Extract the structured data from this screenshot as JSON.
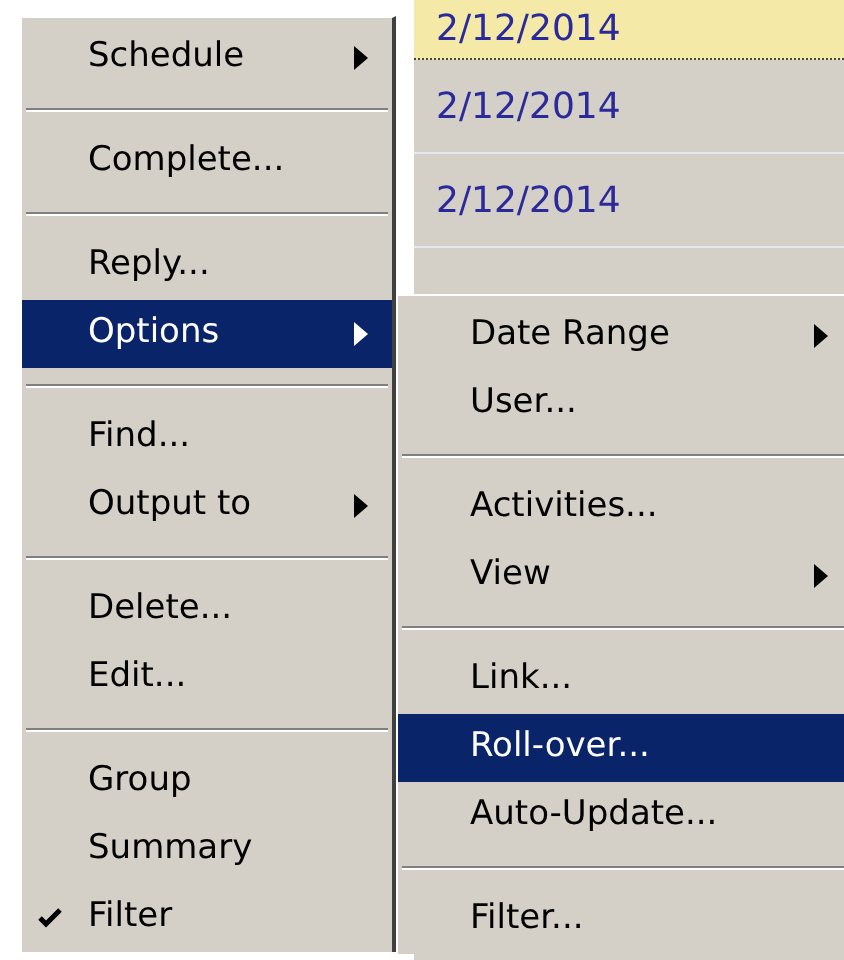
{
  "list": {
    "rows": [
      {
        "date": "2/12/2014",
        "selected": true
      },
      {
        "date": "2/12/2014",
        "selected": false
      },
      {
        "date": "2/12/2014",
        "selected": false
      }
    ]
  },
  "menu": {
    "items": [
      {
        "kind": "item",
        "label": "Schedule",
        "submenu": true,
        "checked": false,
        "selected": false
      },
      {
        "kind": "separator"
      },
      {
        "kind": "item",
        "label": "Complete...",
        "submenu": false,
        "checked": false,
        "selected": false
      },
      {
        "kind": "separator"
      },
      {
        "kind": "item",
        "label": "Reply...",
        "submenu": false,
        "checked": false,
        "selected": false
      },
      {
        "kind": "item",
        "label": "Options",
        "submenu": true,
        "checked": false,
        "selected": true
      },
      {
        "kind": "separator"
      },
      {
        "kind": "item",
        "label": "Find...",
        "submenu": false,
        "checked": false,
        "selected": false
      },
      {
        "kind": "item",
        "label": "Output to",
        "submenu": true,
        "checked": false,
        "selected": false
      },
      {
        "kind": "separator"
      },
      {
        "kind": "item",
        "label": "Delete...",
        "submenu": false,
        "checked": false,
        "selected": false
      },
      {
        "kind": "item",
        "label": "Edit...",
        "submenu": false,
        "checked": false,
        "selected": false
      },
      {
        "kind": "separator"
      },
      {
        "kind": "item",
        "label": "Group",
        "submenu": false,
        "checked": false,
        "selected": false
      },
      {
        "kind": "item",
        "label": "Summary",
        "submenu": false,
        "checked": false,
        "selected": false
      },
      {
        "kind": "item",
        "label": "Filter",
        "submenu": false,
        "checked": true,
        "selected": false
      }
    ]
  },
  "submenu": {
    "items": [
      {
        "kind": "item",
        "label": "Date Range",
        "submenu": true,
        "checked": false,
        "selected": false
      },
      {
        "kind": "item",
        "label": "User...",
        "submenu": false,
        "checked": false,
        "selected": false
      },
      {
        "kind": "separator"
      },
      {
        "kind": "item",
        "label": "Activities...",
        "submenu": false,
        "checked": false,
        "selected": false
      },
      {
        "kind": "item",
        "label": "View",
        "submenu": true,
        "checked": false,
        "selected": false
      },
      {
        "kind": "separator"
      },
      {
        "kind": "item",
        "label": "Link...",
        "submenu": false,
        "checked": false,
        "selected": false
      },
      {
        "kind": "item",
        "label": "Roll-over...",
        "submenu": false,
        "checked": false,
        "selected": true
      },
      {
        "kind": "item",
        "label": "Auto-Update...",
        "submenu": false,
        "checked": false,
        "selected": false
      },
      {
        "kind": "separator"
      },
      {
        "kind": "item",
        "label": "Filter...",
        "submenu": false,
        "checked": false,
        "selected": false
      }
    ]
  }
}
